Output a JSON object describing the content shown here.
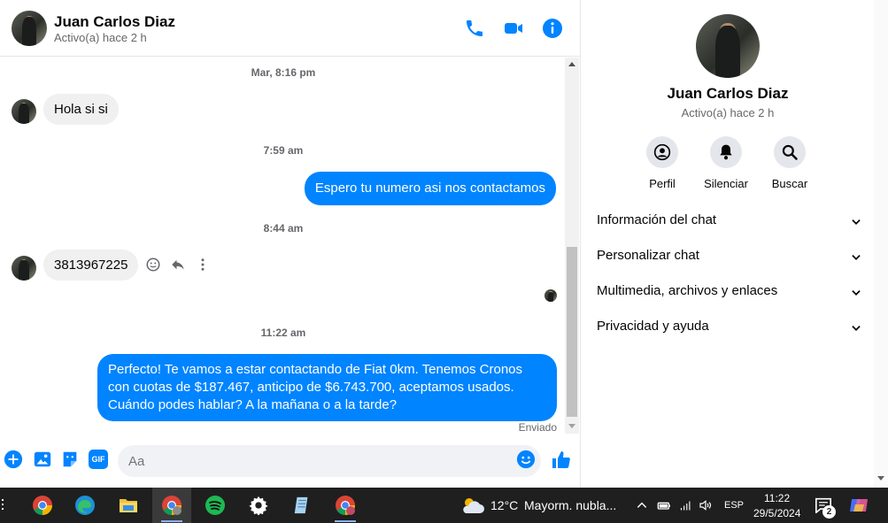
{
  "header": {
    "name": "Juan Carlos Diaz",
    "status": "Activo(a) hace 2 h"
  },
  "messages": {
    "time1": "Mar, 8:16 pm",
    "msg1": "Hola si si",
    "time2": "7:59 am",
    "msg2": "Espero tu numero asi nos contactamos",
    "time3": "8:44 am",
    "msg3": "3813967225",
    "time4": "11:22 am",
    "msg4": "Perfecto! Te vamos a estar contactando de Fiat 0km. Tenemos Cronos con cuotas de $187.467, anticipo de $6.743.700, aceptamos usados. Cuándo podes hablar? A la mañana o a la tarde?",
    "sent": "Enviado"
  },
  "composer": {
    "placeholder": "Aa",
    "gif": "GIF"
  },
  "info": {
    "name": "Juan Carlos Diaz",
    "status": "Activo(a) hace 2 h",
    "actions": [
      "Perfil",
      "Silenciar",
      "Buscar"
    ],
    "sections": [
      "Información del chat",
      "Personalizar chat",
      "Multimedia, archivos y enlaces",
      "Privacidad y ayuda"
    ]
  },
  "taskbar": {
    "weather_temp": "12°C",
    "weather_desc": "Mayorm. nubla...",
    "lang": "ESP",
    "time": "11:22",
    "date": "29/5/2024",
    "notif_count": "2"
  },
  "colors": {
    "accent": "#0084ff",
    "taskbar": "#1f1f1f"
  }
}
